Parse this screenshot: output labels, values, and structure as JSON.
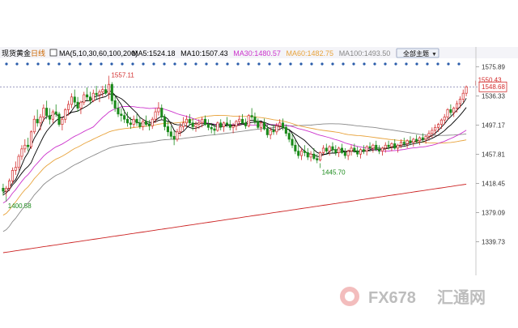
{
  "header": {
    "instrument": "现货黄金",
    "period": "日线",
    "indicator": "MA(5,10,30,60,100,200)",
    "ma_labels": [
      {
        "text": "MA5:1524.18",
        "color": "#000000"
      },
      {
        "text": "MA10:1507.43",
        "color": "#000000"
      },
      {
        "text": "MA30:1480.57",
        "color": "#cc33cc"
      },
      {
        "text": "MA60:1482.75",
        "color": "#e8a33c"
      },
      {
        "text": "MA100:1493.50",
        "color": "#888888"
      },
      {
        "text": "MA200",
        "color": "#cc2222"
      }
    ],
    "dropdown_label": "全部主题"
  },
  "watermark": {
    "brand": "FX678",
    "cn": "汇通网"
  },
  "chart_data": {
    "type": "candlestick",
    "title": "",
    "ylim": [
      1325,
      1585
    ],
    "y_ticks": [
      1575.89,
      1536.33,
      1497.17,
      1457.81,
      1418.45,
      1379.09,
      1339.73
    ],
    "reference_price": 1548.68,
    "colors": {
      "up": "#d22a2a",
      "down": "#1a8a1a",
      "ma5": "#000000",
      "ma10": "#000000",
      "ma30": "#cc33cc",
      "ma60": "#e8a33c",
      "ma100": "#888888",
      "ma200": "#cc2222",
      "price_line": "#7777aa"
    },
    "annotations": [
      {
        "index": 34,
        "price": 1557.11,
        "label": "1557.11",
        "side": "high",
        "color": "#d22a2a"
      },
      {
        "index": 1,
        "price": 1400.58,
        "label": "1400.58",
        "side": "low",
        "color": "#1a8a1a"
      },
      {
        "index": 102,
        "price": 1445.7,
        "label": "1445.70",
        "side": "low",
        "color": "#1a8a1a"
      },
      {
        "index": 152,
        "price": 1550.43,
        "label": "1550.43",
        "side": "high",
        "color": "#d22a2a"
      }
    ],
    "candles": [
      [
        1412,
        1418,
        1402,
        1408
      ],
      [
        1408,
        1415,
        1400.58,
        1412
      ],
      [
        1412,
        1425,
        1408,
        1422
      ],
      [
        1422,
        1440,
        1418,
        1436
      ],
      [
        1436,
        1448,
        1430,
        1440
      ],
      [
        1440,
        1458,
        1436,
        1455
      ],
      [
        1455,
        1470,
        1450,
        1465
      ],
      [
        1465,
        1478,
        1460,
        1470
      ],
      [
        1470,
        1480,
        1462,
        1468
      ],
      [
        1468,
        1490,
        1465,
        1488
      ],
      [
        1488,
        1510,
        1485,
        1505
      ],
      [
        1505,
        1518,
        1495,
        1500
      ],
      [
        1500,
        1512,
        1490,
        1508
      ],
      [
        1508,
        1525,
        1502,
        1520
      ],
      [
        1520,
        1530,
        1505,
        1510
      ],
      [
        1510,
        1520,
        1498,
        1505
      ],
      [
        1505,
        1518,
        1500,
        1515
      ],
      [
        1515,
        1525,
        1508,
        1512
      ],
      [
        1512,
        1515,
        1495,
        1498
      ],
      [
        1498,
        1508,
        1490,
        1505
      ],
      [
        1505,
        1520,
        1500,
        1518
      ],
      [
        1518,
        1530,
        1510,
        1525
      ],
      [
        1525,
        1540,
        1520,
        1535
      ],
      [
        1535,
        1545,
        1522,
        1528
      ],
      [
        1528,
        1535,
        1515,
        1520
      ],
      [
        1520,
        1530,
        1512,
        1528
      ],
      [
        1528,
        1542,
        1524,
        1538
      ],
      [
        1538,
        1548,
        1530,
        1535
      ],
      [
        1535,
        1542,
        1525,
        1530
      ],
      [
        1530,
        1545,
        1528,
        1540
      ],
      [
        1540,
        1550,
        1532,
        1538
      ],
      [
        1538,
        1545,
        1528,
        1542
      ],
      [
        1542,
        1550,
        1535,
        1545
      ],
      [
        1545,
        1552,
        1538,
        1540
      ],
      [
        1540,
        1557.11,
        1532,
        1552
      ],
      [
        1552,
        1555,
        1525,
        1530
      ],
      [
        1530,
        1538,
        1515,
        1520
      ],
      [
        1520,
        1528,
        1508,
        1512
      ],
      [
        1512,
        1520,
        1502,
        1510
      ],
      [
        1510,
        1518,
        1500,
        1505
      ],
      [
        1505,
        1515,
        1495,
        1500
      ],
      [
        1500,
        1508,
        1492,
        1498
      ],
      [
        1498,
        1510,
        1494,
        1505
      ],
      [
        1505,
        1512,
        1496,
        1500
      ],
      [
        1500,
        1508,
        1492,
        1495
      ],
      [
        1495,
        1505,
        1490,
        1502
      ],
      [
        1502,
        1510,
        1495,
        1498
      ],
      [
        1498,
        1504,
        1490,
        1496
      ],
      [
        1496,
        1508,
        1492,
        1505
      ],
      [
        1505,
        1520,
        1500,
        1515
      ],
      [
        1515,
        1528,
        1510,
        1520
      ],
      [
        1520,
        1525,
        1505,
        1508
      ],
      [
        1508,
        1512,
        1490,
        1495
      ],
      [
        1495,
        1502,
        1482,
        1488
      ],
      [
        1488,
        1496,
        1478,
        1482
      ],
      [
        1482,
        1490,
        1470,
        1478
      ],
      [
        1478,
        1492,
        1475,
        1488
      ],
      [
        1488,
        1500,
        1482,
        1495
      ],
      [
        1495,
        1508,
        1490,
        1500
      ],
      [
        1500,
        1510,
        1494,
        1505
      ],
      [
        1505,
        1512,
        1496,
        1500
      ],
      [
        1500,
        1506,
        1490,
        1495
      ],
      [
        1495,
        1502,
        1488,
        1498
      ],
      [
        1498,
        1505,
        1492,
        1500
      ],
      [
        1500,
        1508,
        1494,
        1505
      ],
      [
        1505,
        1510,
        1496,
        1498
      ],
      [
        1498,
        1505,
        1490,
        1494
      ],
      [
        1494,
        1500,
        1486,
        1492
      ],
      [
        1492,
        1498,
        1484,
        1490
      ],
      [
        1490,
        1502,
        1488,
        1500
      ],
      [
        1500,
        1505,
        1490,
        1495
      ],
      [
        1495,
        1502,
        1488,
        1500
      ],
      [
        1500,
        1508,
        1494,
        1498
      ],
      [
        1498,
        1504,
        1490,
        1494
      ],
      [
        1494,
        1500,
        1486,
        1496
      ],
      [
        1496,
        1504,
        1490,
        1502
      ],
      [
        1502,
        1510,
        1496,
        1505
      ],
      [
        1505,
        1512,
        1498,
        1500
      ],
      [
        1500,
        1506,
        1492,
        1496
      ],
      [
        1496,
        1512,
        1494,
        1510
      ],
      [
        1510,
        1520,
        1505,
        1508
      ],
      [
        1508,
        1514,
        1498,
        1502
      ],
      [
        1502,
        1506,
        1492,
        1494
      ],
      [
        1494,
        1502,
        1488,
        1500
      ],
      [
        1500,
        1506,
        1490,
        1492
      ],
      [
        1492,
        1498,
        1480,
        1484
      ],
      [
        1484,
        1494,
        1478,
        1490
      ],
      [
        1490,
        1498,
        1484,
        1488
      ],
      [
        1488,
        1500,
        1484,
        1496
      ],
      [
        1496,
        1505,
        1490,
        1500
      ],
      [
        1500,
        1506,
        1490,
        1494
      ],
      [
        1494,
        1498,
        1482,
        1486
      ],
      [
        1486,
        1492,
        1474,
        1478
      ],
      [
        1478,
        1486,
        1466,
        1470
      ],
      [
        1470,
        1478,
        1458,
        1462
      ],
      [
        1462,
        1470,
        1452,
        1456
      ],
      [
        1456,
        1466,
        1450,
        1462
      ],
      [
        1462,
        1470,
        1455,
        1460
      ],
      [
        1460,
        1466,
        1450,
        1454
      ],
      [
        1454,
        1462,
        1448,
        1458
      ],
      [
        1458,
        1466,
        1450,
        1452
      ],
      [
        1452,
        1458,
        1445.7,
        1450
      ],
      [
        1450,
        1462,
        1448,
        1460
      ],
      [
        1460,
        1470,
        1456,
        1466
      ],
      [
        1466,
        1472,
        1458,
        1462
      ],
      [
        1462,
        1470,
        1456,
        1468
      ],
      [
        1468,
        1474,
        1460,
        1464
      ],
      [
        1464,
        1470,
        1456,
        1460
      ],
      [
        1460,
        1468,
        1454,
        1466
      ],
      [
        1466,
        1472,
        1458,
        1460
      ],
      [
        1460,
        1466,
        1452,
        1456
      ],
      [
        1456,
        1464,
        1450,
        1462
      ],
      [
        1462,
        1470,
        1456,
        1466
      ],
      [
        1466,
        1472,
        1460,
        1462
      ],
      [
        1462,
        1468,
        1454,
        1458
      ],
      [
        1458,
        1466,
        1452,
        1464
      ],
      [
        1464,
        1470,
        1458,
        1462
      ],
      [
        1462,
        1470,
        1456,
        1468
      ],
      [
        1468,
        1474,
        1462,
        1466
      ],
      [
        1466,
        1472,
        1460,
        1470
      ],
      [
        1470,
        1476,
        1462,
        1464
      ],
      [
        1464,
        1470,
        1458,
        1462
      ],
      [
        1462,
        1468,
        1456,
        1466
      ],
      [
        1466,
        1474,
        1460,
        1470
      ],
      [
        1470,
        1476,
        1464,
        1468
      ],
      [
        1468,
        1474,
        1462,
        1472
      ],
      [
        1472,
        1478,
        1464,
        1466
      ],
      [
        1466,
        1472,
        1460,
        1470
      ],
      [
        1470,
        1478,
        1466,
        1474
      ],
      [
        1474,
        1480,
        1468,
        1472
      ],
      [
        1472,
        1478,
        1466,
        1476
      ],
      [
        1476,
        1482,
        1470,
        1474
      ],
      [
        1474,
        1480,
        1468,
        1478
      ],
      [
        1478,
        1484,
        1472,
        1476
      ],
      [
        1476,
        1482,
        1470,
        1480
      ],
      [
        1480,
        1486,
        1474,
        1478
      ],
      [
        1478,
        1484,
        1472,
        1482
      ],
      [
        1482,
        1490,
        1476,
        1486
      ],
      [
        1486,
        1494,
        1480,
        1490
      ],
      [
        1490,
        1498,
        1484,
        1494
      ],
      [
        1494,
        1500,
        1488,
        1498
      ],
      [
        1498,
        1506,
        1492,
        1504
      ],
      [
        1504,
        1512,
        1498,
        1508
      ],
      [
        1508,
        1520,
        1504,
        1518
      ],
      [
        1518,
        1525,
        1510,
        1514
      ],
      [
        1514,
        1522,
        1508,
        1520
      ],
      [
        1520,
        1530,
        1514,
        1526
      ],
      [
        1526,
        1536,
        1520,
        1532
      ],
      [
        1532,
        1545,
        1528,
        1540
      ],
      [
        1540,
        1550.43,
        1536,
        1548.68
      ]
    ]
  }
}
